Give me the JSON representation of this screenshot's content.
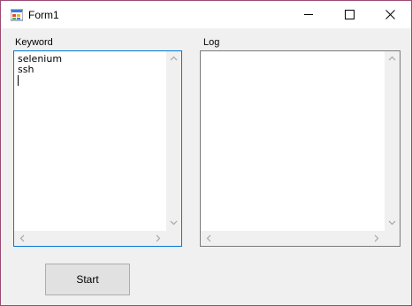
{
  "window": {
    "title": "Form1"
  },
  "titlebar": {
    "minimize_icon": "minimize-icon",
    "maximize_icon": "maximize-icon",
    "close_icon": "close-icon"
  },
  "keyword": {
    "label": "Keyword",
    "lines": [
      "selenium",
      "ssh",
      ""
    ]
  },
  "log": {
    "label": "Log",
    "lines": []
  },
  "start_button": {
    "label": "Start"
  },
  "colors": {
    "focus_border": "#0078d7",
    "window_border": "#9c4a72",
    "background": "#f0f0f0"
  }
}
